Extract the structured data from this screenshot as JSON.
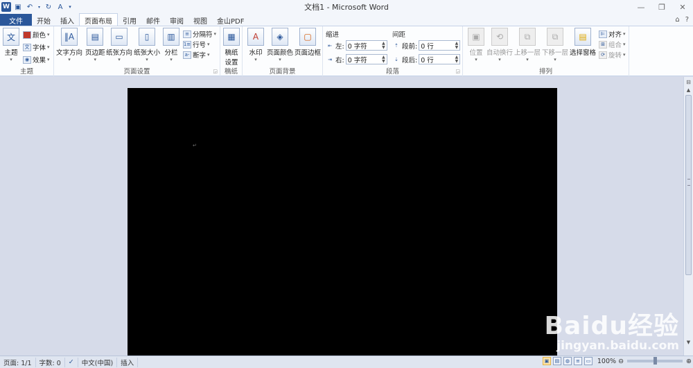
{
  "window": {
    "title": "文档1 - Microsoft Word",
    "app_icon": "W"
  },
  "qat": {
    "icons": [
      "save-icon",
      "undo-icon",
      "redo-icon",
      "format-painter-icon",
      "customize-icon"
    ]
  },
  "win_controls": {
    "minimize": "—",
    "restore": "❐",
    "close": "✕"
  },
  "tabs": [
    {
      "label": "文件"
    },
    {
      "label": "开始"
    },
    {
      "label": "插入"
    },
    {
      "label": "页面布局"
    },
    {
      "label": "引用"
    },
    {
      "label": "邮件"
    },
    {
      "label": "审阅"
    },
    {
      "label": "视图"
    },
    {
      "label": "金山PDF"
    }
  ],
  "tabrow_right": {
    "minimize_ribbon": "⌂",
    "help": "?"
  },
  "ribbon": {
    "theme": {
      "label": "主题",
      "themes_btn": "主题",
      "colors_btn": "颜色",
      "fonts_btn": "字体",
      "effects_btn": "效果"
    },
    "page_setup": {
      "label": "页面设置",
      "text_direction": "文字方向",
      "margins": "页边距",
      "orientation": "纸张方向",
      "size": "纸张大小",
      "columns": "分栏",
      "breaks": "分隔符",
      "line_numbers": "行号",
      "hyphenation": "断字"
    },
    "manuscript": {
      "label": "稿纸",
      "settings_line1": "稿纸",
      "settings_line2": "设置"
    },
    "page_background": {
      "label": "页面背景",
      "watermark": "水印",
      "page_color": "页面颜色",
      "page_borders": "页面边框"
    },
    "paragraph": {
      "label": "段落",
      "indent_head": "缩进",
      "spacing_head": "间距",
      "left_label": "左:",
      "left_value": "0 字符",
      "right_label": "右:",
      "right_value": "0 字符",
      "before_label": "段前:",
      "before_value": "0 行",
      "after_label": "段后:",
      "after_value": "0 行"
    },
    "arrange": {
      "label": "排列",
      "position": "位置",
      "wrap_text": "自动换行",
      "bring_forward": "上移一层",
      "send_backward": "下移一层",
      "selection_pane": "选择窗格",
      "align": "对齐",
      "group": "组合",
      "rotate": "旋转"
    }
  },
  "document": {
    "background_color": "#000000",
    "paragraph_mark": "↵"
  },
  "statusbar": {
    "page": "页面: 1/1",
    "words": "字数: 0",
    "language": "中文(中国)",
    "mode": "插入",
    "zoom": "100%"
  },
  "watermark": {
    "logo": "Baidu经验",
    "url": "jingyan.baidu.com"
  },
  "colors": {
    "accent": "#2b579a",
    "ribbon_bg": "#fcfdfe",
    "workspace_bg": "#d6dbe9"
  }
}
